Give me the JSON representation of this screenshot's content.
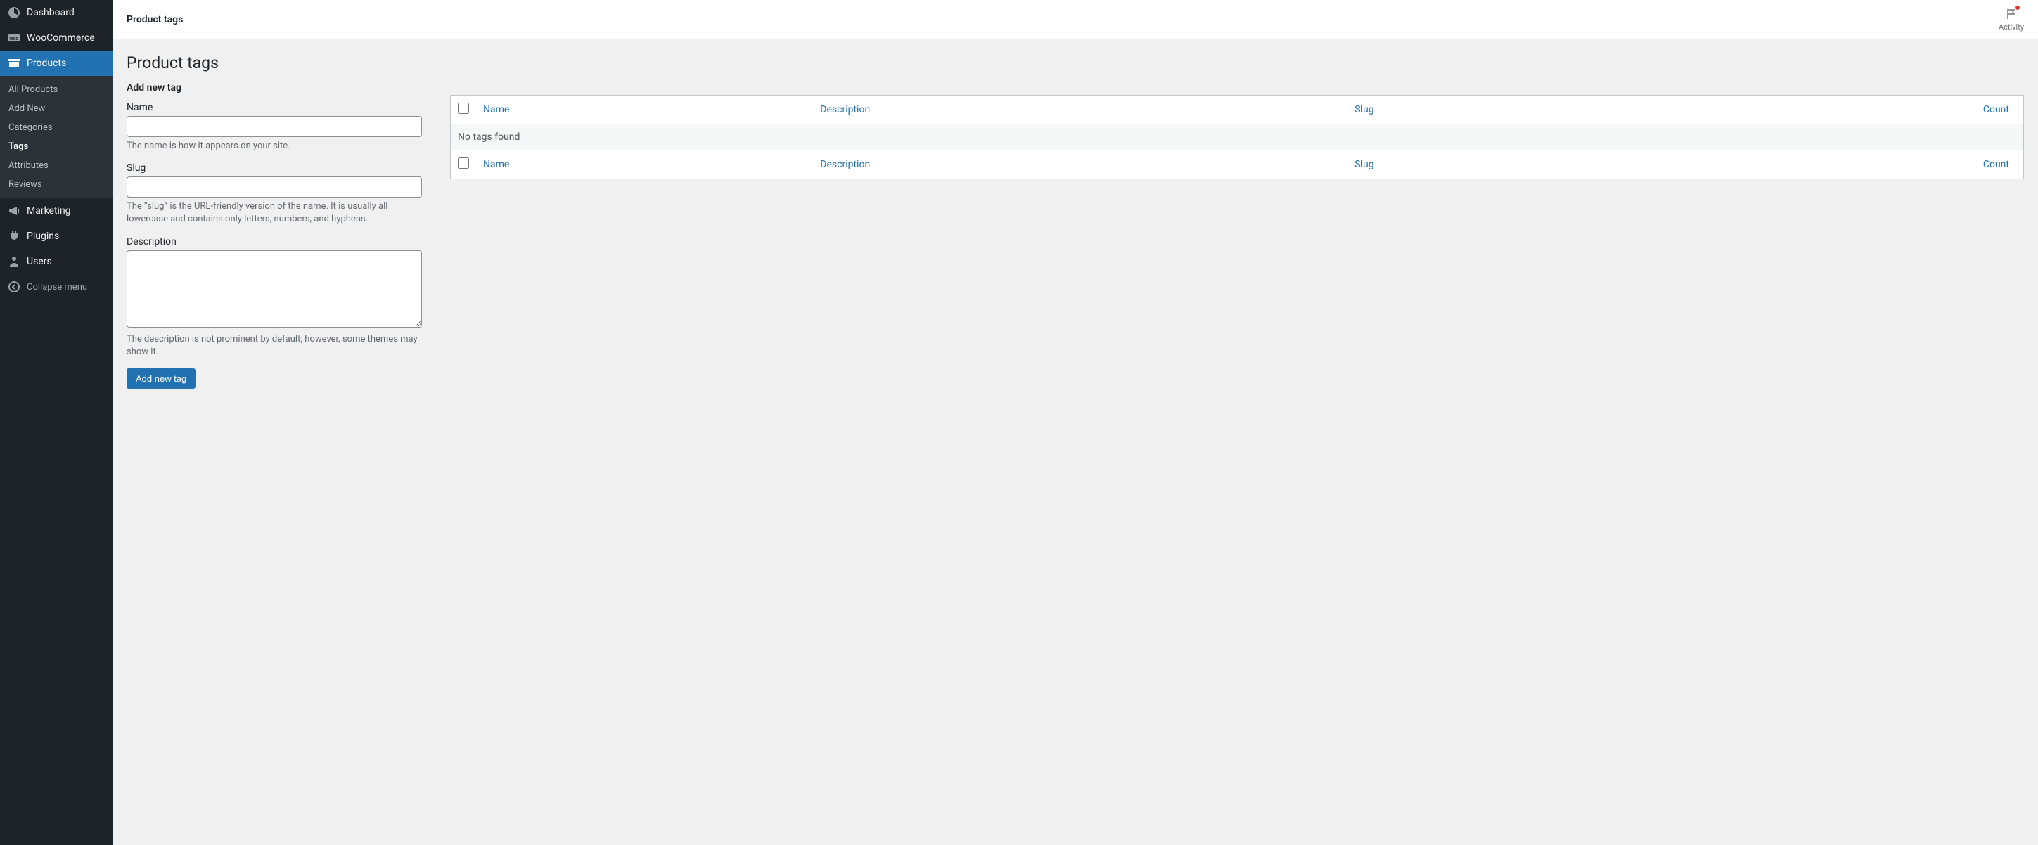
{
  "sidebar": {
    "items": [
      {
        "label": "Dashboard",
        "icon": "dashboard"
      },
      {
        "label": "WooCommerce",
        "icon": "woo"
      },
      {
        "label": "Products",
        "icon": "products",
        "active": true
      },
      {
        "label": "Marketing",
        "icon": "marketing"
      },
      {
        "label": "Plugins",
        "icon": "plugins"
      },
      {
        "label": "Users",
        "icon": "users"
      }
    ],
    "submenu": [
      {
        "label": "All Products"
      },
      {
        "label": "Add New"
      },
      {
        "label": "Categories"
      },
      {
        "label": "Tags",
        "current": true
      },
      {
        "label": "Attributes"
      },
      {
        "label": "Reviews"
      }
    ],
    "collapse_label": "Collapse menu"
  },
  "topbar": {
    "title": "Product tags",
    "activity_label": "Activity"
  },
  "page": {
    "heading": "Product tags",
    "form_heading": "Add new tag",
    "name_label": "Name",
    "name_help": "The name is how it appears on your site.",
    "slug_label": "Slug",
    "slug_help": "The “slug” is the URL-friendly version of the name. It is usually all lowercase and contains only letters, numbers, and hyphens.",
    "desc_label": "Description",
    "desc_help": "The description is not prominent by default; however, some themes may show it.",
    "submit_label": "Add new tag"
  },
  "table": {
    "columns": {
      "name": "Name",
      "description": "Description",
      "slug": "Slug",
      "count": "Count"
    },
    "empty_text": "No tags found"
  }
}
